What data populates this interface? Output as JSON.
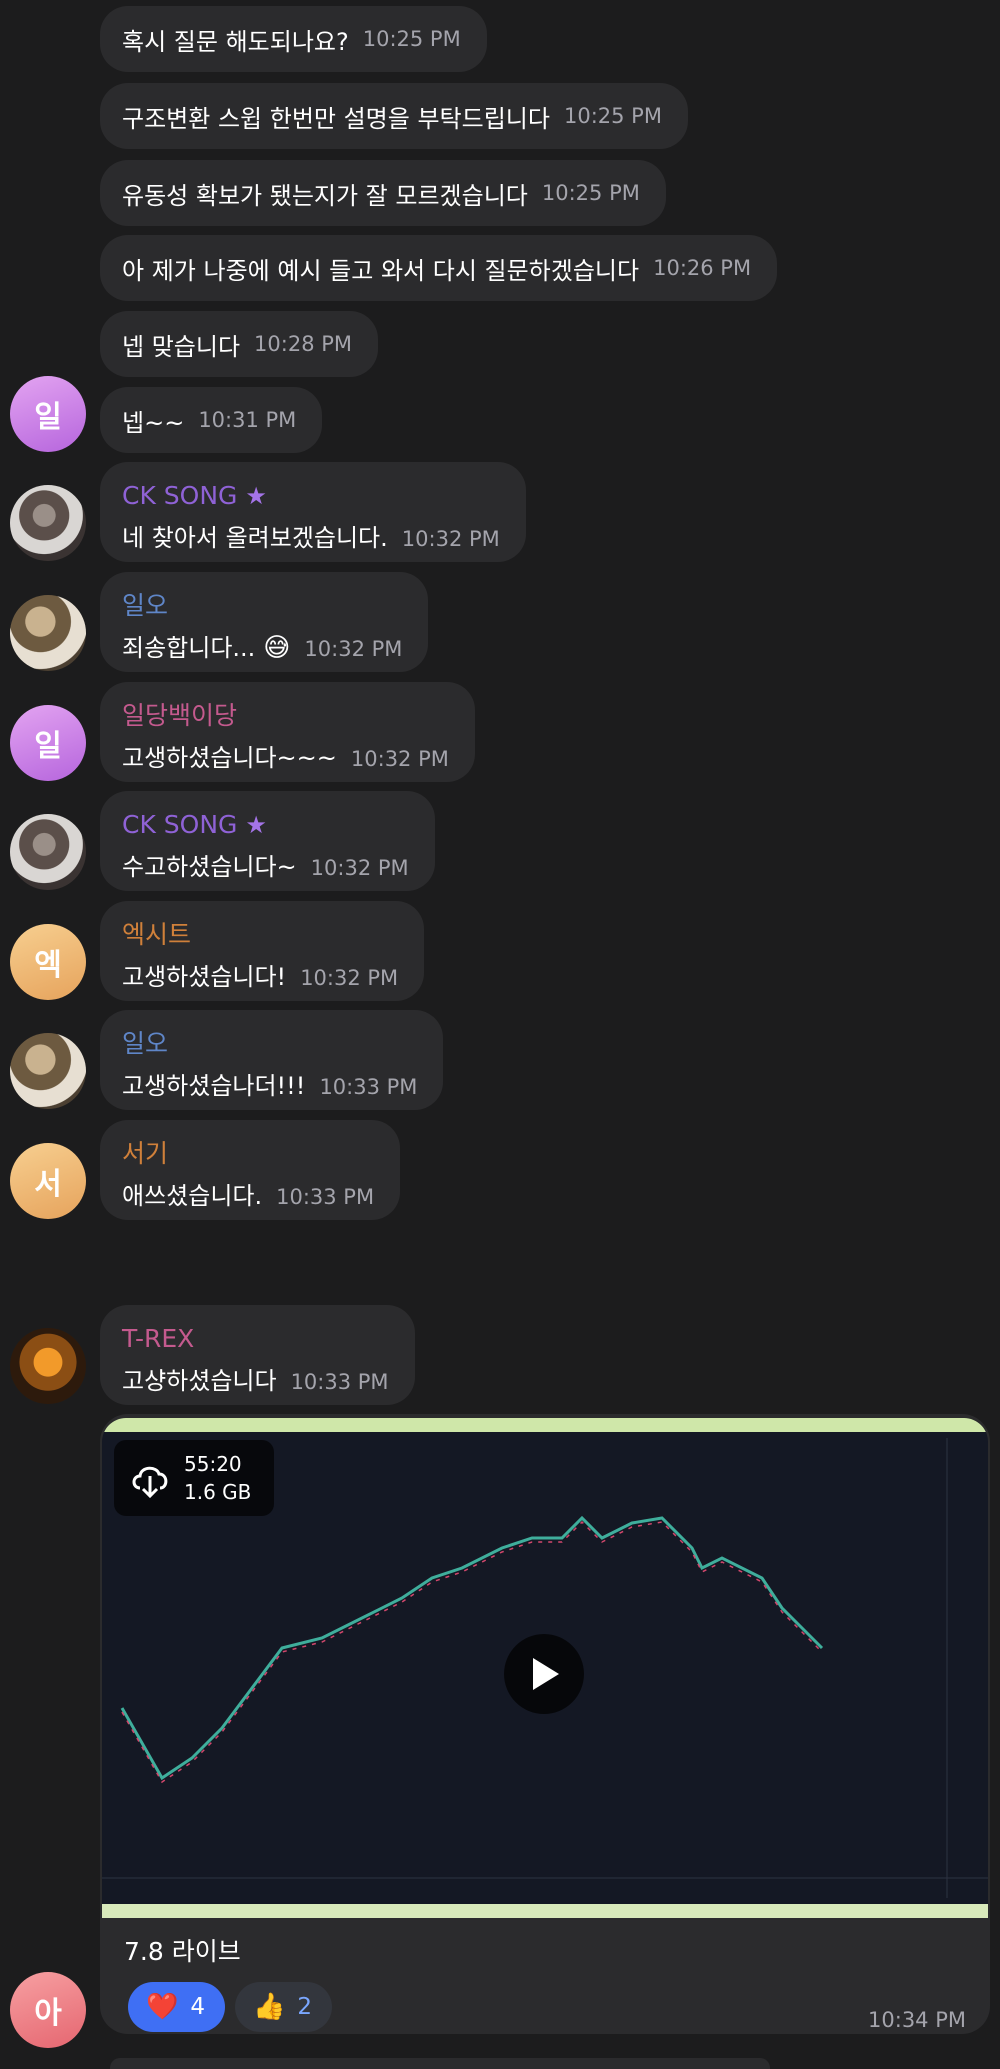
{
  "colors": {
    "background": "#1c1c1d",
    "bubble": "#2b2b2d",
    "time": "#a4a4ac",
    "name_ck": "#8f62d6",
    "name_ilo": "#5f86c8",
    "name_ildang": "#c45a8e",
    "name_exit": "#d0803a",
    "name_seogi": "#d0803a",
    "name_trex": "#c45a8e",
    "reaction_active": "#3f6ff4"
  },
  "messages": [
    {
      "text": "혹시 질문 해도되나요?",
      "time": "10:25 PM"
    },
    {
      "text": "구조변환 스윕 한번만 설명을  부탁드립니다",
      "time": "10:25 PM"
    },
    {
      "text": "유동성 확보가 됐는지가 잘 모르겠습니다",
      "time": "10:25 PM"
    },
    {
      "text": "아 제가 나중에 예시 들고 와서 다시 질문하겠습니다",
      "time": "10:26 PM"
    },
    {
      "text": "넵 맞습니다",
      "time": "10:28 PM"
    },
    {
      "text": "넵~~",
      "time": "10:31 PM",
      "avatar": "일"
    },
    {
      "sender": "CK SONG",
      "badge": "star-icon",
      "text": "네 찾아서 올려보겠습니다.",
      "time": "10:32 PM"
    },
    {
      "sender": "일오",
      "text": "죄송합니다...",
      "emoji": "😅",
      "time": "10:32 PM"
    },
    {
      "sender": "일당백이당",
      "text": "고생하셨습니다~~~",
      "time": "10:32 PM",
      "avatar": "일"
    },
    {
      "sender": "CK SONG",
      "badge": "star-icon",
      "text": "수고하셨습니다~",
      "time": "10:32 PM"
    },
    {
      "sender": "엑시트",
      "text": "고생하셨습니다!",
      "time": "10:32 PM",
      "avatar": "엑"
    },
    {
      "sender": "일오",
      "text": "고생하셨습나더!!!",
      "time": "10:33 PM"
    },
    {
      "sender": "서기",
      "text": "애쓰셨습니다.",
      "time": "10:33 PM",
      "avatar": "서"
    },
    {
      "sender": "T-REX",
      "text": "고샹하셨습니다",
      "time": "10:33 PM"
    }
  ],
  "video": {
    "duration": "55:20",
    "size": "1.6 GB",
    "caption": "7.8 라이브",
    "time": "10:34 PM",
    "sender_avatar": "아",
    "reactions": [
      {
        "emoji": "❤️",
        "count": "4",
        "icon": "heart-icon"
      },
      {
        "emoji": "👍",
        "count": "2",
        "icon": "thumbs-up-icon"
      }
    ]
  }
}
